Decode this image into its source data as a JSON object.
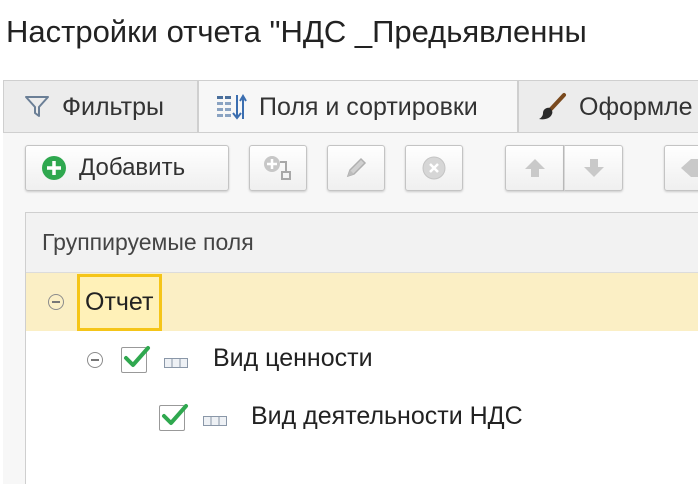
{
  "window": {
    "title": "Настройки отчета \"НДС _Предьявленны"
  },
  "tabs": [
    {
      "label": "Фильтры",
      "icon": "funnel-icon",
      "active": false
    },
    {
      "label": "Поля и сортировки",
      "icon": "fields-sort-icon",
      "active": true
    },
    {
      "label": "Оформле",
      "icon": "paintbrush-icon",
      "active": false
    }
  ],
  "toolbar": {
    "add_label": "Добавить",
    "buttons": [
      "add-button",
      "add-group-button",
      "edit-button",
      "delete-button",
      "move-up-button",
      "move-down-button",
      "more-button"
    ]
  },
  "table": {
    "header": "Группируемые поля",
    "rows": [
      {
        "label": "Отчет",
        "level": 0,
        "checked": null,
        "selected": true,
        "expanded": true
      },
      {
        "label": "Вид ценности",
        "level": 1,
        "checked": true,
        "selected": false,
        "expanded": true
      },
      {
        "label": "Вид деятельности НДС",
        "level": 2,
        "checked": true,
        "selected": false,
        "expanded": null
      }
    ]
  },
  "colors": {
    "accent_green": "#2fa84f",
    "selection_row": "#fbefc5",
    "focus_border": "#f5c518"
  }
}
